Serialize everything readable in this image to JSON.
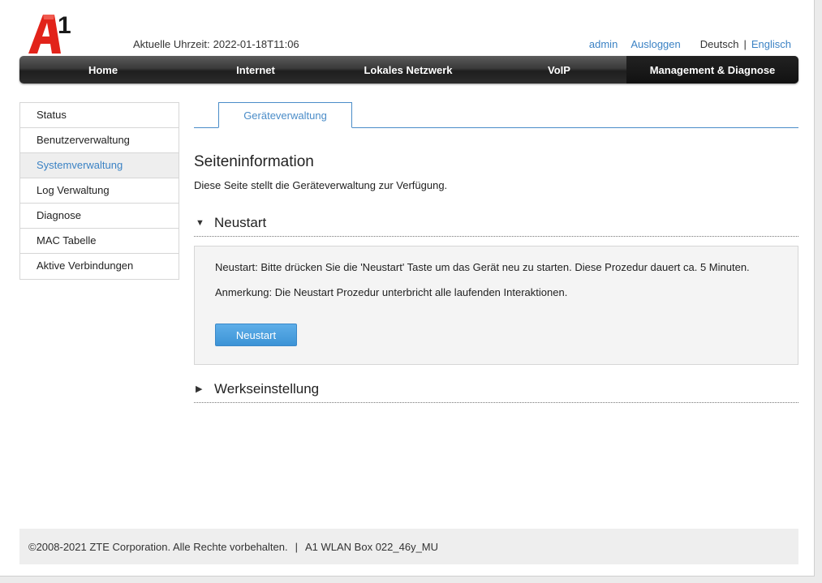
{
  "header": {
    "logo_text": "A1",
    "time_label": "Aktuelle Uhrzeit:",
    "time_value": "2022-01-18T11:06",
    "user": "admin",
    "logout": "Ausloggen",
    "lang_active": "Deutsch",
    "lang_separator": "|",
    "lang_other": "Englisch"
  },
  "nav": {
    "items": [
      {
        "label": "Home"
      },
      {
        "label": "Internet"
      },
      {
        "label": "Lokales Netzwerk"
      },
      {
        "label": "VoIP"
      },
      {
        "label": "Management & Diagnose"
      }
    ],
    "active_index": 4
  },
  "sidebar": {
    "items": [
      {
        "label": "Status"
      },
      {
        "label": "Benutzerverwaltung"
      },
      {
        "label": "Systemverwaltung"
      },
      {
        "label": "Log Verwaltung"
      },
      {
        "label": "Diagnose"
      },
      {
        "label": "MAC Tabelle"
      },
      {
        "label": "Aktive Verbindungen"
      }
    ],
    "active_index": 2
  },
  "tabs": [
    {
      "label": "Geräteverwaltung"
    }
  ],
  "main": {
    "title": "Seiteninformation",
    "description": "Diese Seite stellt die Geräteverwaltung zur Verfügung.",
    "restart": {
      "heading": "Neustart",
      "arrow": "▼",
      "line1": "Neustart: Bitte drücken Sie die 'Neustart' Taste um das Gerät neu zu starten. Diese Prozedur dauert ca. 5 Minuten.",
      "line2": "Anmerkung: Die Neustart Prozedur unterbricht alle laufenden Interaktionen.",
      "button": "Neustart"
    },
    "factory": {
      "heading": "Werkseinstellung",
      "arrow": "▶"
    }
  },
  "footer": {
    "copyright": "©2008-2021 ZTE Corporation. Alle Rechte vorbehalten.",
    "separator": "|",
    "device": "A1 WLAN Box 022_46y_MU"
  },
  "colors": {
    "accent": "#3b82c4",
    "logo_red": "#e2231a",
    "nav_dark": "#2c2c2c",
    "button": "#4aa0e0"
  }
}
